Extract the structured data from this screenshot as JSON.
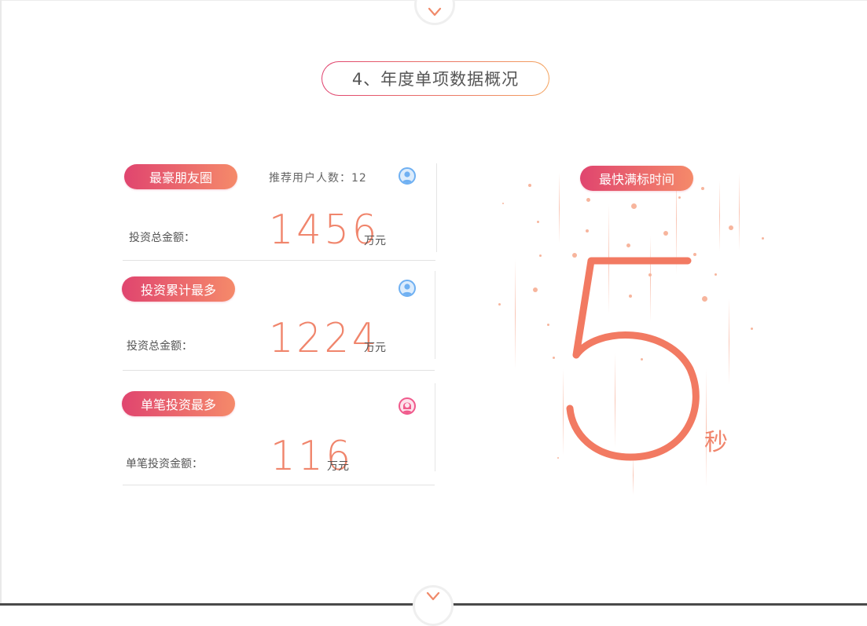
{
  "section_title": "4、年度单项数据概况",
  "cards": [
    {
      "badge": "最豪朋友圈",
      "extra": "推荐用户人数：12",
      "label": "投资总金额：",
      "value": "1456",
      "unit": "万元",
      "icon": "user-icon"
    },
    {
      "badge": "投资累计最多",
      "label": "投资总金额：",
      "value": "1224",
      "unit": "万元",
      "icon": "user-icon"
    },
    {
      "badge": "单笔投资最多",
      "label": "单笔投资金额：",
      "value": "116",
      "unit": "万元",
      "icon": "female-user-icon"
    }
  ],
  "fastest": {
    "badge": "最快满标时间",
    "value": "5",
    "unit": "秒"
  },
  "nav": {
    "up_icon": "chevron-down-icon",
    "down_icon": "chevron-down-icon"
  },
  "colors": {
    "accent_start": "#e0456f",
    "accent_end": "#f58a6a",
    "number": "#f0856c",
    "blue_icon": "#6fb0f2",
    "pink_icon": "#f05a8c"
  }
}
